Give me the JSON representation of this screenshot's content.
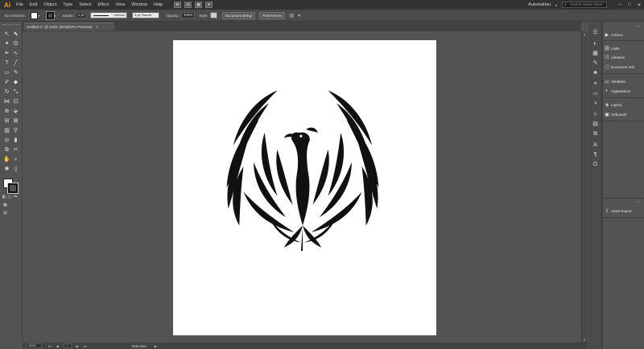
{
  "app": {
    "logo": "Ai"
  },
  "menu": [
    "File",
    "Edit",
    "Object",
    "Type",
    "Select",
    "Effect",
    "View",
    "Window",
    "Help"
  ],
  "menu_app_icons": [
    "Br",
    "St"
  ],
  "workspace": "Automation",
  "search": {
    "placeholder": "Search Adobe Stock"
  },
  "window_controls": [
    "–",
    "□",
    "✕"
  ],
  "control": {
    "selection": "No Selection",
    "stroke_label": "Stroke:",
    "stroke_value": "1 pt",
    "profile": "Uniform",
    "brush": "5 pt. Round",
    "opacity_label": "Opacity:",
    "opacity_value": "100%",
    "style_label": "Style:",
    "document_setup": "Document Setup",
    "preferences": "Preferences"
  },
  "document_tab": {
    "title": "Untitled-1* @ 116% (RGB/GPU Preview)",
    "close": "✕"
  },
  "status": {
    "zoom": "116%",
    "page": "1",
    "tool": "Selection"
  },
  "panels": [
    {
      "icon": "play-icon",
      "glyph": "▶",
      "label": "Actions"
    },
    {
      "icon": "link-icon",
      "glyph": "⛓",
      "label": "Links"
    },
    {
      "icon": "libraries-icon",
      "glyph": "☷",
      "label": "Libraries"
    },
    {
      "icon": "document-info-icon",
      "glyph": "ⓘ",
      "label": "Document Info"
    },
    {
      "icon": "variables-icon",
      "glyph": "{x}",
      "label": "Variables"
    },
    {
      "icon": "appearance-icon",
      "glyph": "◐",
      "label": "Appearance"
    },
    {
      "icon": "layers-icon",
      "glyph": "◈",
      "label": "Layers"
    },
    {
      "icon": "artboards-icon",
      "glyph": "▣",
      "label": "Artboards"
    },
    {
      "icon": "asset-export-icon",
      "glyph": "⇪",
      "label": "Asset Export"
    }
  ],
  "colors": {
    "menubar": "#323232",
    "panel": "#535353",
    "accent_logo": "#ff9a00",
    "artboard": "#ffffff"
  }
}
